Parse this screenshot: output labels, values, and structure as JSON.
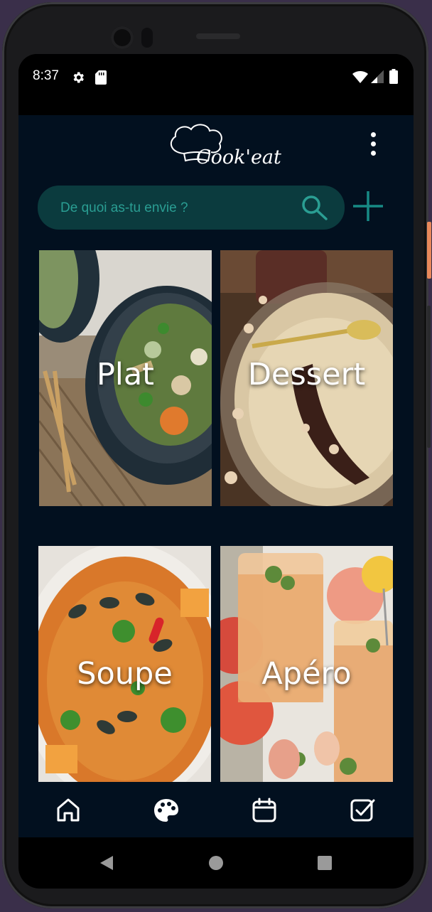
{
  "status_bar": {
    "time": "8:37"
  },
  "header": {
    "logo_text": "Cook'eat"
  },
  "search": {
    "placeholder": "De quoi as-tu envie ?"
  },
  "categories": [
    {
      "label": "Plat"
    },
    {
      "label": "Dessert"
    },
    {
      "label": "Soupe"
    },
    {
      "label": "Apéro"
    }
  ],
  "bottom_nav": [
    {
      "icon": "home-icon"
    },
    {
      "icon": "palette-icon",
      "active": true
    },
    {
      "icon": "calendar-icon"
    },
    {
      "icon": "checkbox-icon"
    }
  ],
  "colors": {
    "app_background": "#02101f",
    "search_background": "#0b3b3e",
    "accent_teal": "#2a9e93",
    "icon_white": "#ffffff"
  }
}
